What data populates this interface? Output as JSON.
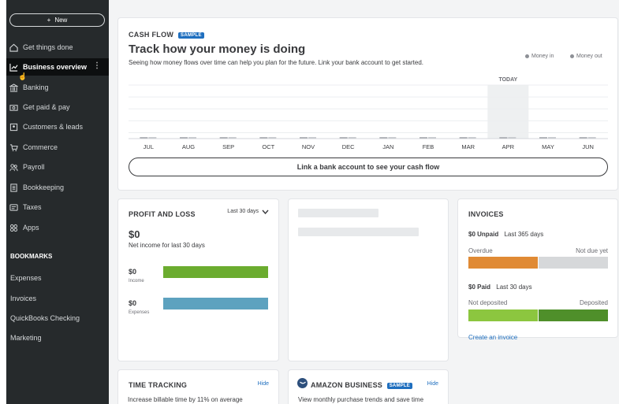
{
  "sidebar": {
    "new_label": "New",
    "items": [
      {
        "label": "Get things done",
        "icon": "home-icon"
      },
      {
        "label": "Business overview",
        "icon": "chart-icon"
      },
      {
        "label": "Banking",
        "icon": "bank-icon"
      },
      {
        "label": "Get paid & pay",
        "icon": "money-icon"
      },
      {
        "label": "Customers & leads",
        "icon": "contacts-icon"
      },
      {
        "label": "Commerce",
        "icon": "commerce-icon"
      },
      {
        "label": "Payroll",
        "icon": "people-icon"
      },
      {
        "label": "Bookkeeping",
        "icon": "ledger-icon"
      },
      {
        "label": "Taxes",
        "icon": "taxes-icon"
      },
      {
        "label": "Apps",
        "icon": "apps-icon"
      }
    ],
    "active_item": "Business overview",
    "bookmarks_title": "BOOKMARKS",
    "bookmarks": [
      "Expenses",
      "Invoices",
      "QuickBooks Checking",
      "Marketing"
    ]
  },
  "cash_flow": {
    "label": "CASH FLOW",
    "badge": "SAMPLE",
    "title": "Track how your money is doing",
    "subtitle": "Seeing how money flows over time can help you plan for the future. Link your bank account to get started.",
    "legend_in": "Money in",
    "legend_out": "Money out",
    "today_label": "TODAY",
    "link_button": "Link a bank account to see your cash flow"
  },
  "chart_data": {
    "type": "bar",
    "categories": [
      "JUL",
      "AUG",
      "SEP",
      "OCT",
      "NOV",
      "DEC",
      "JAN",
      "FEB",
      "MAR",
      "APR",
      "MAY",
      "JUN"
    ],
    "series": [
      {
        "name": "Money in",
        "values": [
          0,
          0,
          0,
          0,
          0,
          0,
          0,
          0,
          0,
          0,
          0,
          0
        ]
      },
      {
        "name": "Money out",
        "values": [
          0,
          0,
          0,
          0,
          0,
          0,
          0,
          0,
          0,
          0,
          0,
          0
        ]
      }
    ],
    "highlight_category": "APR",
    "grid": true,
    "legend": "top-right"
  },
  "profit_loss": {
    "title": "PROFIT AND LOSS",
    "range": "Last 30 days",
    "amount": "$0",
    "net_label": "Net income for last 30 days",
    "income_value": "$0",
    "income_label": "Income",
    "expenses_value": "$0",
    "expenses_label": "Expenses",
    "income_color": "#6bac2f",
    "expenses_color": "#5da2bf"
  },
  "invoices": {
    "title": "INVOICES",
    "unpaid_amount": "$0 Unpaid",
    "unpaid_period": "Last 365 days",
    "overdue_label": "Overdue",
    "not_due_label": "Not due yet",
    "paid_amount": "$0 Paid",
    "paid_period": "Last 30 days",
    "not_deposited_label": "Not deposited",
    "deposited_label": "Deposited",
    "create_link": "Create an invoice",
    "overdue_color": "#e08a34",
    "not_due_color": "#d6d8da",
    "not_deposited_color": "#8cc63f",
    "deposited_color": "#4f8f2a"
  },
  "time_tracking": {
    "title": "TIME TRACKING",
    "hide": "Hide",
    "body": "Increase billable time by 11% on average"
  },
  "amazon": {
    "title": "AMAZON BUSINESS",
    "badge": "SAMPLE",
    "hide": "Hide",
    "body": "View monthly purchase trends and save time"
  }
}
